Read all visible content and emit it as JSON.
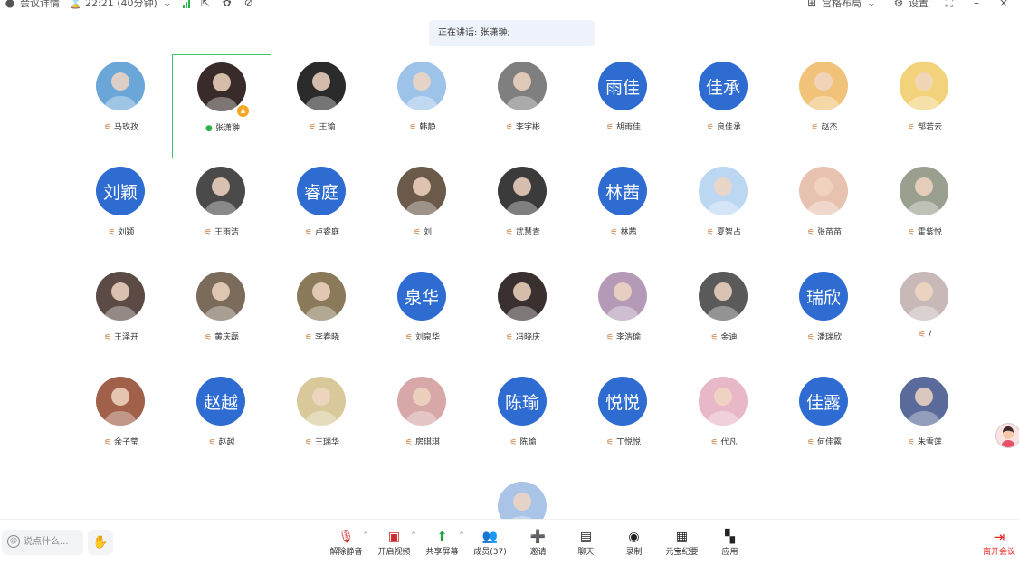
{
  "topbar": {
    "meeting_info": "会议详情",
    "timer": "22:21 (40分钟)",
    "layout": "宫格布局",
    "settings": "设置"
  },
  "speaking": "正在讲话: 张潇翀;",
  "participants": [
    {
      "name": "马玫孜",
      "row": 0,
      "col": 0,
      "type": "photo",
      "color": "#6aa6d8"
    },
    {
      "name": "张潇翀",
      "row": 0,
      "col": 1,
      "type": "photo",
      "color": "#3a2b2b",
      "active": true,
      "mic": "on",
      "host": true
    },
    {
      "name": "王瑜",
      "row": 0,
      "col": 2,
      "type": "photo",
      "color": "#2b2b2b"
    },
    {
      "name": "韩静",
      "row": 0,
      "col": 3,
      "type": "photo",
      "color": "#9ec3e8"
    },
    {
      "name": "李宇彬",
      "row": 0,
      "col": 4,
      "type": "photo",
      "color": "#7f7f7f"
    },
    {
      "name": "胡雨佳",
      "row": 0,
      "col": 5,
      "type": "text",
      "initials": "雨佳"
    },
    {
      "name": "良佳承",
      "row": 0,
      "col": 6,
      "type": "text",
      "initials": "佳承"
    },
    {
      "name": "赵杰",
      "row": 0,
      "col": 7,
      "type": "photo",
      "color": "#f1c37a"
    },
    {
      "name": "郜若云",
      "row": 0,
      "col": 8,
      "type": "photo",
      "color": "#f2d27a"
    },
    {
      "name": "刘颖",
      "row": 1,
      "col": 0,
      "type": "text",
      "initials": "刘颖"
    },
    {
      "name": "王雨洁",
      "row": 1,
      "col": 1,
      "type": "photo",
      "color": "#4a4a4a"
    },
    {
      "name": "卢睿庭",
      "row": 1,
      "col": 2,
      "type": "text",
      "initials": "睿庭"
    },
    {
      "name": "刘",
      "row": 1,
      "col": 3,
      "type": "photo",
      "color": "#6b5a4a"
    },
    {
      "name": "武慧青",
      "row": 1,
      "col": 4,
      "type": "photo",
      "color": "#3b3b3b"
    },
    {
      "name": "林茜",
      "row": 1,
      "col": 5,
      "type": "text",
      "initials": "林茜"
    },
    {
      "name": "夏智占",
      "row": 1,
      "col": 6,
      "type": "photo",
      "color": "#bcd7f2"
    },
    {
      "name": "张苗苗",
      "row": 1,
      "col": 7,
      "type": "photo",
      "color": "#e8c2b0"
    },
    {
      "name": "霍紫悦",
      "row": 1,
      "col": 8,
      "type": "photo",
      "color": "#9aa08f"
    },
    {
      "name": "王泽开",
      "row": 2,
      "col": 0,
      "type": "photo",
      "color": "#5b4b44"
    },
    {
      "name": "黄庆磊",
      "row": 2,
      "col": 1,
      "type": "photo",
      "color": "#7b6b5b"
    },
    {
      "name": "李春晓",
      "row": 2,
      "col": 2,
      "type": "photo",
      "color": "#8a7a5a"
    },
    {
      "name": "刘泉华",
      "row": 2,
      "col": 3,
      "type": "text",
      "initials": "泉华"
    },
    {
      "name": "冯晓庆",
      "row": 2,
      "col": 4,
      "type": "photo",
      "color": "#3a3030"
    },
    {
      "name": "李浩瑜",
      "row": 2,
      "col": 5,
      "type": "photo",
      "color": "#b59ab8"
    },
    {
      "name": "金迪",
      "row": 2,
      "col": 6,
      "type": "photo",
      "color": "#5a5a5a"
    },
    {
      "name": "潘瑞欣",
      "row": 2,
      "col": 7,
      "type": "text",
      "initials": "瑞欣"
    },
    {
      "name": "/",
      "row": 2,
      "col": 8,
      "type": "photo",
      "color": "#c8b8b8"
    },
    {
      "name": "余子莹",
      "row": 3,
      "col": 0,
      "type": "photo",
      "color": "#a0604a"
    },
    {
      "name": "赵越",
      "row": 3,
      "col": 1,
      "type": "text",
      "initials": "赵越"
    },
    {
      "name": "王瑞华",
      "row": 3,
      "col": 2,
      "type": "photo",
      "color": "#d8c89a"
    },
    {
      "name": "房琪琪",
      "row": 3,
      "col": 3,
      "type": "photo",
      "color": "#d8a8a8"
    },
    {
      "name": "陈瑜",
      "row": 3,
      "col": 4,
      "type": "text",
      "initials": "陈瑜"
    },
    {
      "name": "丁悦悦",
      "row": 3,
      "col": 5,
      "type": "text",
      "initials": "悦悦"
    },
    {
      "name": "代凡",
      "row": 3,
      "col": 6,
      "type": "photo",
      "color": "#e8b8c8"
    },
    {
      "name": "何佳露",
      "row": 3,
      "col": 7,
      "type": "text",
      "initials": "佳露"
    },
    {
      "name": "朱雪莲",
      "row": 3,
      "col": 8,
      "type": "photo",
      "color": "#5a6a9a"
    },
    {
      "name": "",
      "row": 4,
      "col": 4,
      "type": "photo",
      "color": "#aac4e8",
      "partial": true
    }
  ],
  "bottom": {
    "say_placeholder": "说点什么...",
    "tools": [
      {
        "label": "解除静音",
        "icon": "mic-muted-icon",
        "glyph": "🎙",
        "red": true,
        "caret": true
      },
      {
        "label": "开启视频",
        "icon": "camera-off-icon",
        "glyph": "▣",
        "red": true,
        "caret": true
      },
      {
        "label": "共享屏幕",
        "icon": "share-screen-icon",
        "glyph": "⬆",
        "green": true,
        "caret": true
      },
      {
        "label": "成员(37)",
        "icon": "members-icon",
        "glyph": "👥"
      },
      {
        "label": "邀请",
        "icon": "invite-icon",
        "glyph": "➕"
      },
      {
        "label": "聊天",
        "icon": "chat-icon",
        "glyph": "▤"
      },
      {
        "label": "录制",
        "icon": "record-icon",
        "glyph": "◉"
      },
      {
        "label": "元宝纪要",
        "icon": "notes-icon",
        "glyph": "▦"
      },
      {
        "label": "应用",
        "icon": "apps-icon",
        "glyph": "▚"
      }
    ],
    "leave": "离开会议"
  }
}
